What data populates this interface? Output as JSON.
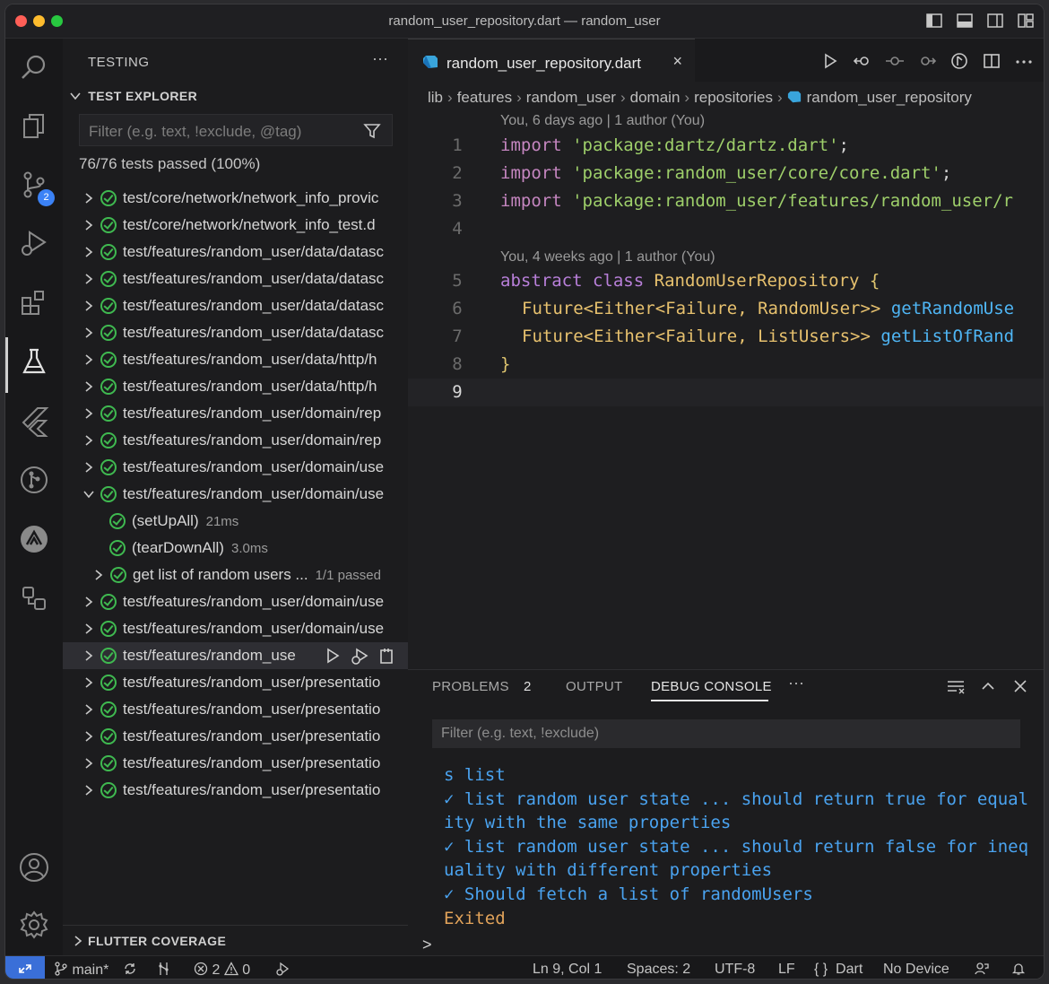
{
  "window": {
    "title": "random_user_repository.dart — random_user"
  },
  "activity": {
    "scm_badge": "2"
  },
  "sidebar": {
    "title": "TESTING",
    "more": "···",
    "explorer_title": "TEST EXPLORER",
    "filter_placeholder": "Filter (e.g. text, !exclude, @tag)",
    "summary": "76/76 tests passed (100%)",
    "coverage_title": "FLUTTER COVERAGE",
    "tests": [
      {
        "label": "test/core/network/network_info_provic",
        "indent": 0,
        "expanded": false
      },
      {
        "label": "test/core/network/network_info_test.d",
        "indent": 0,
        "expanded": false
      },
      {
        "label": "test/features/random_user/data/datasc",
        "indent": 0,
        "expanded": false
      },
      {
        "label": "test/features/random_user/data/datasc",
        "indent": 0,
        "expanded": false
      },
      {
        "label": "test/features/random_user/data/datasc",
        "indent": 0,
        "expanded": false
      },
      {
        "label": "test/features/random_user/data/datasc",
        "indent": 0,
        "expanded": false
      },
      {
        "label": "test/features/random_user/data/http/h",
        "indent": 0,
        "expanded": false
      },
      {
        "label": "test/features/random_user/data/http/h",
        "indent": 0,
        "expanded": false
      },
      {
        "label": "test/features/random_user/domain/rep",
        "indent": 0,
        "expanded": false
      },
      {
        "label": "test/features/random_user/domain/rep",
        "indent": 0,
        "expanded": false
      },
      {
        "label": "test/features/random_user/domain/use",
        "indent": 0,
        "expanded": false
      },
      {
        "label": "test/features/random_user/domain/use",
        "indent": 0,
        "expanded": true
      },
      {
        "label": "(setUpAll)",
        "duration": "21ms",
        "indent": 2,
        "leaf": true
      },
      {
        "label": "(tearDownAll)",
        "duration": "3.0ms",
        "indent": 2,
        "leaf": true
      },
      {
        "label": "get list of random users ...",
        "duration": "1/1 passed",
        "indent": 1,
        "expanded": false
      },
      {
        "label": "test/features/random_user/domain/use",
        "indent": 0,
        "expanded": false
      },
      {
        "label": "test/features/random_user/domain/use",
        "indent": 0,
        "expanded": false
      },
      {
        "label": "test/features/random_use",
        "indent": 0,
        "expanded": false,
        "selected": true
      },
      {
        "label": "test/features/random_user/presentatio",
        "indent": 0,
        "expanded": false
      },
      {
        "label": "test/features/random_user/presentatio",
        "indent": 0,
        "expanded": false
      },
      {
        "label": "test/features/random_user/presentatio",
        "indent": 0,
        "expanded": false
      },
      {
        "label": "test/features/random_user/presentatio",
        "indent": 0,
        "expanded": false
      },
      {
        "label": "test/features/random_user/presentatio",
        "indent": 0,
        "expanded": false
      }
    ]
  },
  "editor": {
    "tab_name": "random_user_repository.dart",
    "tab_close": "×",
    "breadcrumb": [
      "lib",
      "features",
      "random_user",
      "domain",
      "repositories",
      "random_user_repository"
    ],
    "blame1": "You, 6 days ago | 1 author (You)",
    "blame2": "You, 4 weeks ago | 1 author (You)",
    "line_numbers": [
      "1",
      "2",
      "3",
      "4",
      "5",
      "6",
      "7",
      "8",
      "9"
    ],
    "code": {
      "l1_kw": "import",
      "l1_str": "'package:dartz/dartz.dart'",
      "l1_end": ";",
      "l2_kw": "import",
      "l2_str": "'package:random_user/core/core.dart'",
      "l2_end": ";",
      "l3_kw": "import",
      "l3_str": "'package:random_user/features/random_user/r",
      "l5_kw1": "abstract",
      "l5_kw2": "class",
      "l5_cls": "RandomUserRepository",
      "l5_brace": "{",
      "l6_type": "Future<Either<Failure, RandomUser>>",
      "l6_fn": "getRandomUse",
      "l7_type": "Future<Either<Failure, ListUsers>>",
      "l7_fn": "getListOfRand",
      "l8_brace": "}"
    }
  },
  "panel": {
    "tabs": {
      "problems": "PROBLEMS",
      "problems_count": "2",
      "output": "OUTPUT",
      "debug": "DEBUG CONSOLE",
      "more": "···"
    },
    "filter_placeholder": "Filter (e.g. text, !exclude)",
    "console_lines": [
      "s list",
      "✓ list random user state ... should return true for equal",
      "ity with the same properties",
      "✓ list random user state ... should return false for ineq",
      "uality with different properties",
      "✓ Should fetch a list of randomUsers"
    ],
    "exit_line": "Exited",
    "prompt": ">"
  },
  "status": {
    "branch": "main*",
    "errors": "2",
    "warnings": "0",
    "position": "Ln 9, Col 1",
    "spaces": "Spaces: 2",
    "encoding": "UTF-8",
    "eol": "LF",
    "language_braces": "{ }",
    "language": "Dart",
    "device": "No Device"
  },
  "colors": {
    "pass": "#3fb950",
    "accent": "#3a6fd8",
    "badge": "#3b82f6"
  }
}
